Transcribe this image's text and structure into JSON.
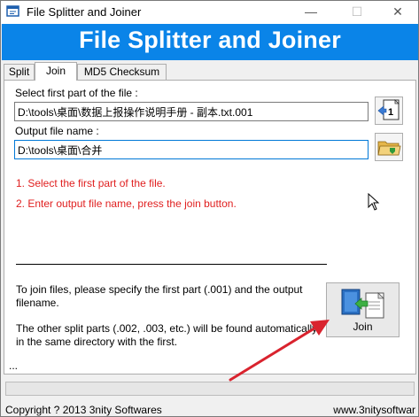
{
  "window": {
    "title": "File Splitter and Joiner",
    "minimize_glyph": "—",
    "maximize_glyph": "☐",
    "close_glyph": "✕"
  },
  "banner": {
    "title": "File Splitter and Joiner"
  },
  "tabs": [
    {
      "label": "Split",
      "active": false
    },
    {
      "label": "Join",
      "active": true
    },
    {
      "label": "MD5 Checksum",
      "active": false
    }
  ],
  "join": {
    "first_part_label": "Select first part of the file :",
    "first_part_value": "D:\\tools\\桌面\\数据上报操作说明手册 - 副本.txt.001",
    "output_label": "Output file name :",
    "output_value": "D:\\tools\\桌面\\合并",
    "instruction_1": "1. Select the first part of the file.",
    "instruction_2": "2. Enter output file name, press the join button.",
    "info_1": "To join files, please specify the first part (.001) and the output filename.",
    "info_2": "The other split parts (.002, .003, etc.) will be found automatically in the same directory with the first.",
    "join_button_label": "Join",
    "status_ellipsis": "...",
    "open_icon": "open-first-part-icon",
    "folder_icon": "folder-save-icon"
  },
  "progress": {
    "fraction": 0.0
  },
  "statusbar": {
    "copyright": "Copyright ? 2013 3nity Softwares",
    "website": "www.3nitysoftwar"
  },
  "colors": {
    "banner": "#0a84e8",
    "instruction_text": "#e01f1f",
    "annotation_arrow": "#d9232e"
  }
}
